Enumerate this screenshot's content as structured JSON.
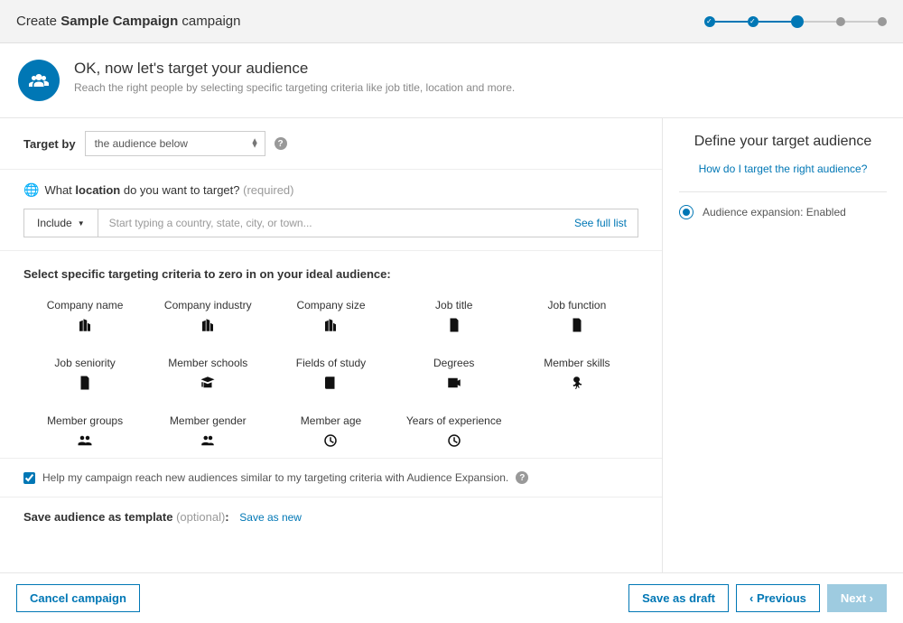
{
  "header": {
    "prefix": "Create ",
    "campaign_name": "Sample Campaign",
    "suffix": " campaign"
  },
  "hero": {
    "title": "OK, now let's target your audience",
    "subtitle": "Reach the right people by selecting specific targeting criteria like job title, location and more."
  },
  "target_by": {
    "label": "Target by",
    "selected": "the audience below"
  },
  "location": {
    "question_prefix": "What ",
    "question_bold": "location",
    "question_suffix": " do you want to target? ",
    "required_label": "(required)",
    "include_label": "Include",
    "placeholder": "Start typing a country, state, city, or town...",
    "see_full_list": "See full list"
  },
  "criteria": {
    "title": "Select specific targeting criteria to zero in on your ideal audience:",
    "items": [
      "Company name",
      "Company industry",
      "Company size",
      "Job title",
      "Job function",
      "Job seniority",
      "Member schools",
      "Fields of study",
      "Degrees",
      "Member skills",
      "Member groups",
      "Member gender",
      "Member age",
      "Years of experience"
    ]
  },
  "audience_expansion": {
    "checkbox_label": "Help my campaign reach new audiences similar to my targeting criteria with Audience Expansion."
  },
  "save_template": {
    "label": "Save audience as template ",
    "optional": "(optional)",
    "colon": ":",
    "save_new": "Save as new"
  },
  "footer": {
    "cancel": "Cancel campaign",
    "save_draft": "Save as draft",
    "previous": "‹ Previous",
    "next": "Next ›"
  },
  "sidebar": {
    "title": "Define your target audience",
    "help_link": "How do I target the right audience?",
    "aud_exp_label": "Audience expansion:",
    "aud_exp_value": "Enabled"
  }
}
